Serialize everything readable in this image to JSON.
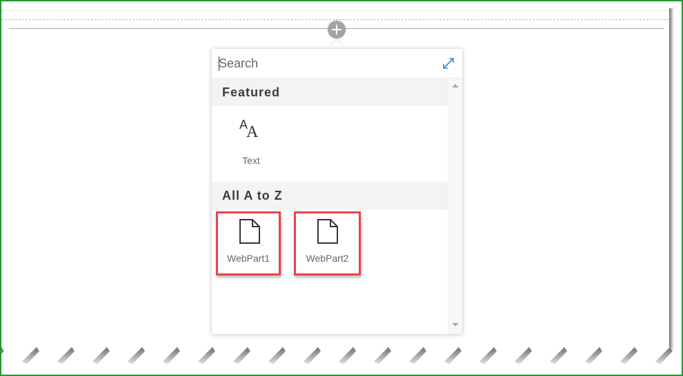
{
  "canvas": {
    "add_section_button_label": "+"
  },
  "toolbox": {
    "search": {
      "placeholder": "Search",
      "value": ""
    },
    "expand_icon": "expand-diagonal-icon",
    "groups": [
      {
        "title": "Featured",
        "items": [
          {
            "label": "Text",
            "icon": "text-AA-icon"
          }
        ]
      },
      {
        "title": "All A to Z",
        "items": [
          {
            "label": "WebPart1",
            "icon": "document-page-icon",
            "highlighted": true
          },
          {
            "label": "WebPart2",
            "icon": "document-page-icon",
            "highlighted": true
          }
        ]
      }
    ],
    "scrollbar": {
      "up_icon": "scroll-up-arrow-icon",
      "down_icon": "scroll-down-arrow-icon"
    }
  },
  "colors": {
    "frame_border": "#1f9a2e",
    "highlight_box": "#e8434a",
    "accent_blue": "#2b88d8",
    "group_header_bg": "#f3f3f3",
    "add_button": "#a3a3a3"
  }
}
